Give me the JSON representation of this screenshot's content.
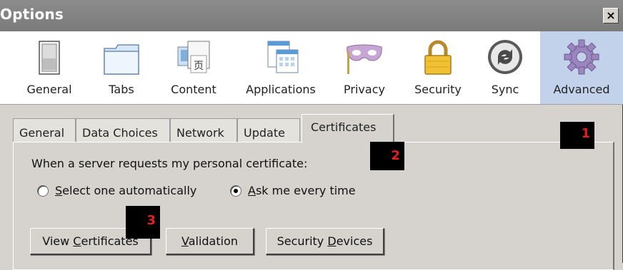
{
  "window": {
    "title": "Options",
    "close_label": "×"
  },
  "categories": [
    {
      "label": "General",
      "icon": "switch-icon"
    },
    {
      "label": "Tabs",
      "icon": "tabs-icon"
    },
    {
      "label": "Content",
      "icon": "content-icon"
    },
    {
      "label": "Applications",
      "icon": "applications-icon"
    },
    {
      "label": "Privacy",
      "icon": "mask-icon"
    },
    {
      "label": "Security",
      "icon": "padlock-icon"
    },
    {
      "label": "Sync",
      "icon": "sync-icon"
    },
    {
      "label": "Advanced",
      "icon": "gear-icon",
      "selected": true
    }
  ],
  "tabs": [
    {
      "label": "General"
    },
    {
      "label": "Data Choices"
    },
    {
      "label": "Network"
    },
    {
      "label": "Update"
    },
    {
      "label": "Certificates",
      "active": true
    }
  ],
  "certificates": {
    "prompt": "When a server requests my personal certificate:",
    "option_auto_prefix": "S",
    "option_auto_rest": "elect one automatically",
    "option_ask_prefix": "A",
    "option_ask_rest": "sk me every time",
    "selected_option": "Ask me every time"
  },
  "buttons": {
    "view_certificates_prefix": "View ",
    "view_certificates_key": "C",
    "view_certificates_rest": "ertificates",
    "validation_key": "V",
    "validation_rest": "alidation",
    "security_devices_prefix": "Security ",
    "security_devices_key": "D",
    "security_devices_rest": "evices"
  },
  "badges": [
    "1",
    "2",
    "3"
  ],
  "colors": {
    "titlebar": "#808080",
    "toolbar_bg": "#ffffff",
    "selected_category": "#c2d2ea",
    "badge_text": "#e62020"
  }
}
